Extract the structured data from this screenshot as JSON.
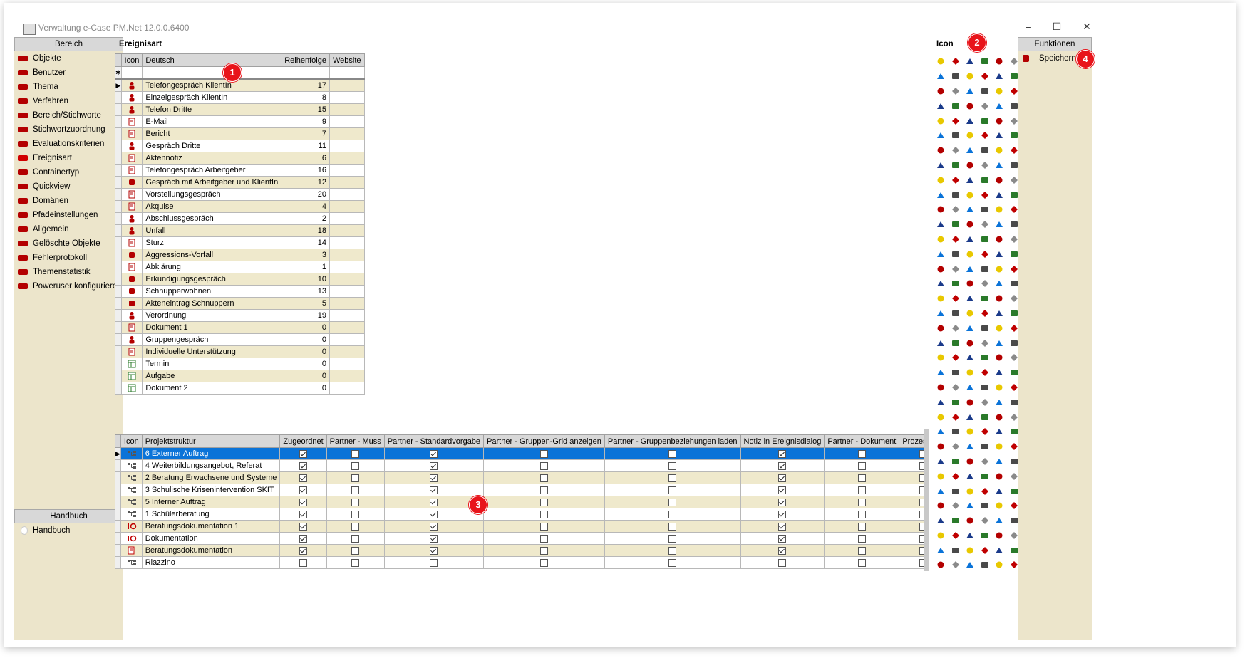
{
  "window": {
    "title": "Verwaltung e-Case PM.Net 12.0.0.6400",
    "controls": [
      "–",
      "☐",
      "✕"
    ]
  },
  "left_panel": {
    "title": "Bereich",
    "items": [
      "Objekte",
      "Benutzer",
      "Thema",
      "Verfahren",
      "Bereich/Stichworte",
      "Stichwortzuordnung",
      "Evaluationskriterien",
      "Ereignisart",
      "Containertyp",
      "Quickview",
      "Domänen",
      "Pfadeinstellungen",
      "Allgemein",
      "Gelöschte Objekte",
      "Fehlerprotokoll",
      "Themenstatistik",
      "Poweruser konfigurieren"
    ],
    "selected": "Ereignisart",
    "handbuch_title": "Handbuch",
    "handbuch_items": [
      "Handbuch"
    ]
  },
  "ereignisart": {
    "label": "Ereignisart",
    "new_row_marker": "✱",
    "current_row_marker": "▶",
    "columns": [
      "Icon",
      "Deutsch",
      "Reihenfolge",
      "Website"
    ],
    "rows": [
      {
        "name": "Telefongespräch KlientIn",
        "order": "17"
      },
      {
        "name": "Einzelgespräch KlientIn",
        "order": "8"
      },
      {
        "name": "Telefon Dritte",
        "order": "15"
      },
      {
        "name": "E-Mail",
        "order": "9"
      },
      {
        "name": "Bericht",
        "order": "7"
      },
      {
        "name": "Gespräch Dritte",
        "order": "11"
      },
      {
        "name": "Aktennotiz",
        "order": "6"
      },
      {
        "name": "Telefongespräch Arbeitgeber",
        "order": "16"
      },
      {
        "name": "Gespräch mit Arbeitgeber und KlientIn",
        "order": "12"
      },
      {
        "name": "Vorstellungsgespräch",
        "order": "20"
      },
      {
        "name": "Akquise",
        "order": "4"
      },
      {
        "name": "Abschlussgespräch",
        "order": "2"
      },
      {
        "name": "Unfall",
        "order": "18"
      },
      {
        "name": "Sturz",
        "order": "14"
      },
      {
        "name": "Aggressions-Vorfall",
        "order": "3"
      },
      {
        "name": "Abklärung",
        "order": "1"
      },
      {
        "name": "Erkundigungsgespräch",
        "order": "10"
      },
      {
        "name": "Schnupperwohnen",
        "order": "13"
      },
      {
        "name": "Akteneintrag Schnuppern",
        "order": "5"
      },
      {
        "name": "Verordnung",
        "order": "19"
      },
      {
        "name": "Dokument 1",
        "order": "0"
      },
      {
        "name": "Gruppengespräch",
        "order": "0"
      },
      {
        "name": "Individuelle Unterstützung",
        "order": "0"
      },
      {
        "name": "Termin",
        "order": "0"
      },
      {
        "name": "Aufgabe",
        "order": "0"
      },
      {
        "name": "Dokument 2",
        "order": "0"
      }
    ]
  },
  "projekt": {
    "current_row_marker": "▶",
    "columns": [
      "Icon",
      "Projektstruktur",
      "Zugeordnet",
      "Partner - Muss",
      "Partner - Standardvorgabe",
      "Partner - Gruppen-Grid anzeigen",
      "Partner - Gruppenbeziehungen laden",
      "Notiz in Ereignisdialog",
      "Partner - Dokument",
      "ProzessLog"
    ],
    "rows": [
      {
        "name": "6 Externer Auftrag",
        "checks": [
          true,
          false,
          true,
          false,
          false,
          true,
          false,
          false
        ],
        "selected": true
      },
      {
        "name": "4 Weiterbildungsangebot, Referat",
        "checks": [
          true,
          false,
          true,
          false,
          false,
          true,
          false,
          false
        ]
      },
      {
        "name": "2 Beratung Erwachsene und Systeme",
        "checks": [
          true,
          false,
          true,
          false,
          false,
          true,
          false,
          false
        ]
      },
      {
        "name": "3 Schulische Krisenintervention SKIT",
        "checks": [
          true,
          false,
          true,
          false,
          false,
          true,
          false,
          false
        ]
      },
      {
        "name": "5 Interner Auftrag",
        "checks": [
          true,
          false,
          true,
          false,
          false,
          true,
          false,
          false
        ]
      },
      {
        "name": "1 Schülerberatung",
        "checks": [
          true,
          false,
          true,
          false,
          false,
          true,
          false,
          false
        ]
      },
      {
        "name": "Beratungsdokumentation 1",
        "checks": [
          true,
          false,
          true,
          false,
          false,
          true,
          false,
          false
        ]
      },
      {
        "name": "Dokumentation",
        "checks": [
          true,
          false,
          true,
          false,
          false,
          true,
          false,
          false
        ]
      },
      {
        "name": "Beratungsdokumentation",
        "checks": [
          true,
          false,
          true,
          false,
          false,
          true,
          false,
          false
        ]
      },
      {
        "name": "Riazzino",
        "checks": [
          false,
          false,
          false,
          false,
          false,
          false,
          false,
          false
        ]
      }
    ]
  },
  "icon_panel": {
    "label": "Icon",
    "palette": [
      "#2a7a2a",
      "#1a3a8a",
      "#c00000",
      "#e8c800",
      "#4a4a4a",
      "#0a73d8",
      "#8a8a8a",
      "#b30000"
    ]
  },
  "functions": {
    "title": "Funktionen",
    "save_label": "Speichern"
  },
  "badges": [
    "1",
    "2",
    "3",
    "4"
  ]
}
